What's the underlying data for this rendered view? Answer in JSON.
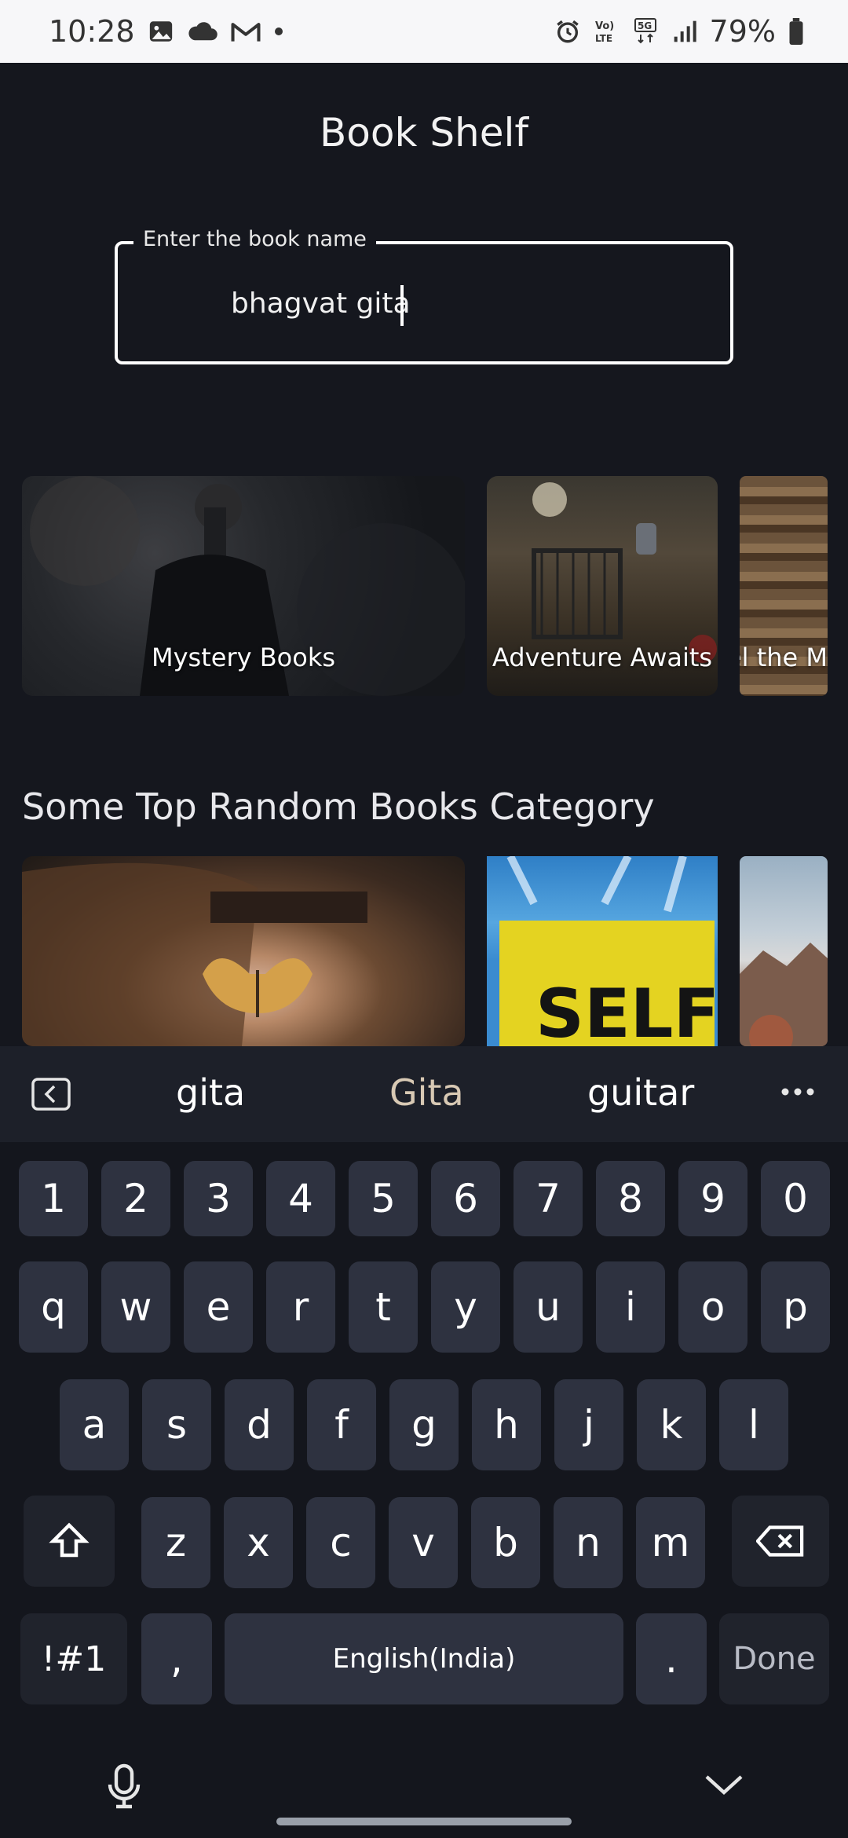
{
  "status_bar": {
    "time": "10:28",
    "battery_pct": "79%",
    "left_icons": [
      "image-icon",
      "cloud-icon",
      "gmail-icon",
      "dot-icon"
    ],
    "right_icons": [
      "alarm-icon",
      "volte-icon",
      "5g-icon",
      "signal-icon",
      "battery-icon"
    ],
    "volte_label": "Vo) LTE",
    "network_label": "5G"
  },
  "app": {
    "title": "Book Shelf",
    "search": {
      "label": "Enter the book name",
      "value": "bhagvat gita"
    },
    "carousel_1": [
      {
        "label": "Mystery Books"
      },
      {
        "label": "Adventure Awaits"
      },
      {
        "label": "el the M"
      }
    ],
    "section_title": "Some Top Random Books Category",
    "carousel_2": [
      {
        "label": ""
      },
      {
        "label": "SELF"
      },
      {
        "label": ""
      }
    ]
  },
  "keyboard": {
    "suggestions": [
      "gita",
      "Gita",
      "guitar"
    ],
    "row_numbers": [
      "1",
      "2",
      "3",
      "4",
      "5",
      "6",
      "7",
      "8",
      "9",
      "0"
    ],
    "row_top": [
      "q",
      "w",
      "e",
      "r",
      "t",
      "y",
      "u",
      "i",
      "o",
      "p"
    ],
    "row_mid": [
      "a",
      "s",
      "d",
      "f",
      "g",
      "h",
      "j",
      "k",
      "l"
    ],
    "row_bottom": [
      "z",
      "x",
      "c",
      "v",
      "b",
      "n",
      "m"
    ],
    "symbols_label": "!#1",
    "comma_label": ",",
    "space_label": "English(India)",
    "period_label": ".",
    "done_label": "Done"
  },
  "colors": {
    "background": "#15171e",
    "keyboard_key": "#2e3240",
    "status_bar": "#f7f7f9"
  }
}
